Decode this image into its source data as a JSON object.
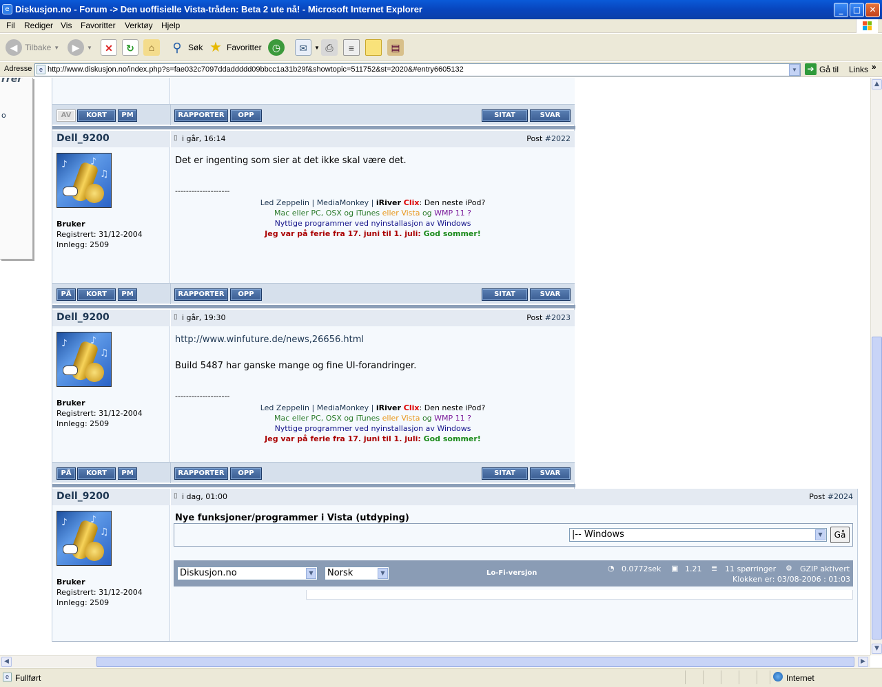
{
  "window": {
    "title": "Diskusjon.no - Forum -> Den uoffisielle Vista-tråden: Beta 2 ute nå! - Microsoft Internet Explorer"
  },
  "menu": [
    "Fil",
    "Rediger",
    "Vis",
    "Favoritter",
    "Verktøy",
    "Hjelp"
  ],
  "toolbar": {
    "back": "Tilbake",
    "search": "Søk",
    "favorites": "Favoritter"
  },
  "address": {
    "label": "Adresse",
    "url": "http://www.diskusjon.no/index.php?s=fae032c7097ddaddddd09bbcc1a31b29f&showtopic=511752&st=2020&#entry6605132",
    "go": "Gå til",
    "links": "Links"
  },
  "sidebar": {
    "fragment": "rrer",
    "fragment2": "o"
  },
  "buttons": {
    "av": "AV",
    "pa": "PÅ",
    "kort": "KORT",
    "pm": "PM",
    "rapporter": "RAPPORTER",
    "opp": "OPP",
    "sitat": "SITAT",
    "svar": "SVAR"
  },
  "signature": {
    "line1a": "Led Zeppelin | MediaMonkey | ",
    "line1b": "iRiver",
    "line1c": " Clix",
    "line1d": ": Den neste iPod?",
    "line2a": "Mac eller PC, OSX og iTunes ",
    "line2b": "eller Vista",
    "line2c": " og ",
    "line2d": "WMP 11 ?",
    "line3": "Nyttige programmer ved nyinstallasjon av Windows",
    "line4a": "Jeg var på ferie fra 17. juni til 1. juli: ",
    "line4b": "God sommer!",
    "divider": "--------------------"
  },
  "posts": [
    {
      "author": "Dell_9200",
      "date": "i går, 16:14",
      "post_label": "Post ",
      "post_num": "#2022",
      "role": "Bruker",
      "registered": "Registrert: 31/12-2004",
      "posts_count": "Innlegg: 2509",
      "body": "Det er ingenting som sier at det ikke skal være det."
    },
    {
      "author": "Dell_9200",
      "date": "i går, 19:30",
      "post_label": "Post ",
      "post_num": "#2023",
      "role": "Bruker",
      "registered": "Registrert: 31/12-2004",
      "posts_count": "Innlegg: 2509",
      "link": "http://www.winfuture.de/news,26656.html",
      "body": "Build 5487 har ganske mange og fine UI-forandringer."
    },
    {
      "author": "Dell_9200",
      "date": "i dag, 01:00",
      "post_label": "Post ",
      "post_num": "#2024",
      "role": "Bruker",
      "registered": "Registrert: 31/12-2004",
      "posts_count": "Innlegg: 2509",
      "heading": "Nye funksjoner/programmer i Vista (utdyping)"
    }
  ],
  "forum_jump": {
    "selected": "|-- Windows",
    "go": "Gå"
  },
  "footer": {
    "skin": "Diskusjon.no",
    "language": "Norsk",
    "lofi": "Lo-Fi-versjon",
    "time": "0.0772sek",
    "load": "1.21",
    "queries": "11 spørringer",
    "gzip": "GZIP aktivert",
    "clock": "Klokken er: 03/08-2006 : 01:03"
  },
  "status": {
    "text": "Fullført",
    "zone": "Internet"
  }
}
